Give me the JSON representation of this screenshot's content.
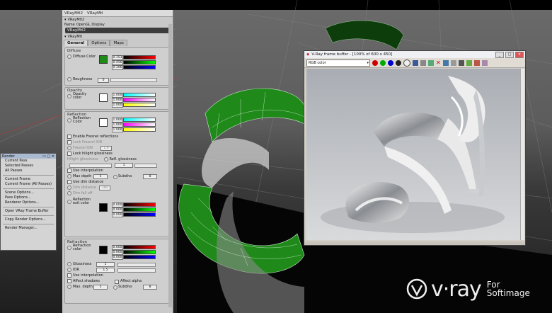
{
  "panel": {
    "tabs_top": [
      "VRayMtl2",
      "VRayMtl"
    ],
    "subtitle": "VRayMtl2",
    "subtabs": [
      "Name",
      "OpenGL Display"
    ],
    "name_value": "VRayMtl2",
    "section_label": "VRayMtl",
    "tabs": [
      "General",
      "Options",
      "Maps"
    ],
    "diffuse": {
      "header": "Diffuse",
      "color_label": "Diffuse Color",
      "rgb": [
        "0.153",
        "0.456",
        "0.106"
      ],
      "roughness_label": "Roughness",
      "roughness": "0"
    },
    "opacity": {
      "header": "Opacity",
      "label": "Opacity color",
      "rgb": [
        "1.000",
        "1.000",
        "1.000"
      ]
    },
    "reflection": {
      "header": "Reflection",
      "color_label": "Reflection Color",
      "rgb": [
        "1.000",
        "1.000",
        "1.000"
      ],
      "enable_fresnel": "Enable Fresnel reflections",
      "lock_fresnel": "Lock Fresnel IOR",
      "fresnel_ior": "Fresnel IOR",
      "fresnel_ior_value": "1.6",
      "lock_hilight": "Lock hilight glossiness",
      "hilight_gloss": "Hilight glossiness",
      "refl_gloss": "Refl. glossiness",
      "refl_gloss_value": "1",
      "use_interp": "Use interpolation",
      "max_depth_label": "Max depth",
      "max_depth": "5",
      "subdivs_label": "Subdivs",
      "subdivs": "8",
      "dim_distance": "Use dim distance",
      "dim_dist": "Dim distance",
      "dim_dist_value": "100",
      "dim_falloff": "Dim fall off",
      "exit_label": "Reflection exit color",
      "exit_rgb": [
        "0.000",
        "0.000",
        "0.000"
      ]
    },
    "refraction": {
      "header": "Refraction",
      "color_label": "Refraction color",
      "rgb": [
        "0.000",
        "0.000",
        "0.000"
      ],
      "gloss_label": "Glossiness",
      "gloss_value": "1",
      "ior_label": "IOR",
      "ior_value": "1.5",
      "use_interp": "Use interpolation",
      "affect_shadows": "Affect shadows",
      "affect_alpha": "Affect alpha",
      "max_depth_label": "Max. depth",
      "max_depth": "5",
      "subdivs_label": "Subdivs",
      "subdivs": "8"
    }
  },
  "render_menu": {
    "title": "Render",
    "items": [
      "Current Pass",
      "Selected Passes",
      "All Passes",
      "Current Frame",
      "Current Frame (All Passes)",
      "Scene Options...",
      "Pass Options...",
      "Renderer Options...",
      "Open VRay Frame Buffer",
      "Copy Render Options...",
      "Render Manager..."
    ]
  },
  "vfb": {
    "title": "V-Ray frame buffer - [100% of 600 x 450]",
    "channel": "RGB color",
    "win_controls": [
      "_",
      "□",
      "×"
    ]
  },
  "logo": {
    "main": "v·ray",
    "sub1": "For",
    "sub2": "Softimage"
  },
  "colors": {
    "green": "#1f8a1a",
    "panel_bg": "#c9c9c9",
    "vfb_bg": "#d4d0c8"
  }
}
